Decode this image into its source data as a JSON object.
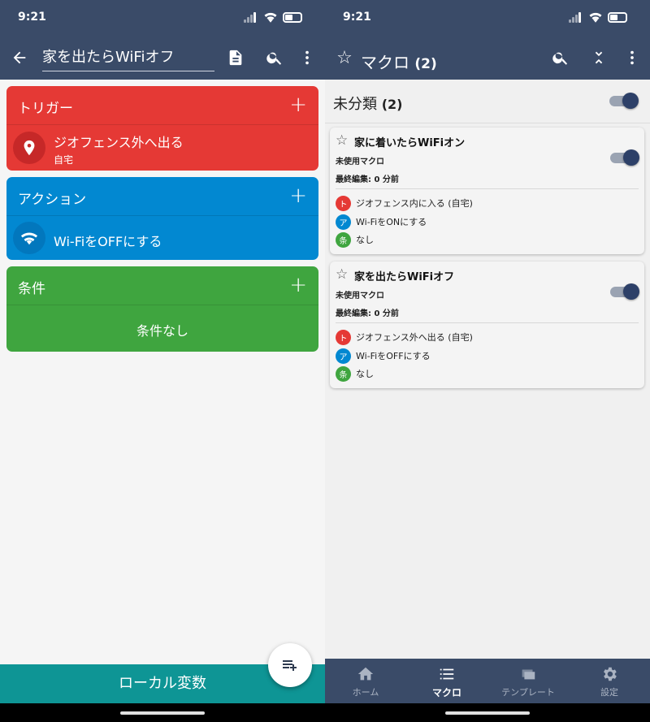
{
  "left": {
    "status_time": "9:21",
    "macro_name": "家を出たらWiFiオフ",
    "trigger": {
      "title": "トリガー",
      "item_label": "ジオフェンス外へ出る",
      "item_sub": "自宅",
      "color": "#e53935"
    },
    "action": {
      "title": "アクション",
      "item_label": "Wi-FiをOFFにする",
      "color": "#0288d1"
    },
    "constraint": {
      "title": "条件",
      "empty_label": "条件なし",
      "color": "#3fa53f"
    },
    "local_vars_label": "ローカル変数"
  },
  "right": {
    "status_time": "9:21",
    "title": "マクロ",
    "title_count": "(2)",
    "category": {
      "name": "未分類",
      "count": "(2)"
    },
    "macros": [
      {
        "name": "家に着いたらWiFiオン",
        "status": "未使用マクロ",
        "last_edit": "最終編集: 0 分前",
        "rows": [
          {
            "badge": "ト",
            "color": "#e53935",
            "text": "ジオフェンス内に入る (自宅)"
          },
          {
            "badge": "ア",
            "color": "#0288d1",
            "text": "Wi-FiをONにする"
          },
          {
            "badge": "条",
            "color": "#3fa53f",
            "text": "なし"
          }
        ]
      },
      {
        "name": "家を出たらWiFiオフ",
        "status": "未使用マクロ",
        "last_edit": "最終編集: 0 分前",
        "rows": [
          {
            "badge": "ト",
            "color": "#e53935",
            "text": "ジオフェンス外へ出る (自宅)"
          },
          {
            "badge": "ア",
            "color": "#0288d1",
            "text": "Wi-FiをOFFにする"
          },
          {
            "badge": "条",
            "color": "#3fa53f",
            "text": "なし"
          }
        ]
      }
    ],
    "fab_label": "+",
    "nav": [
      {
        "label": "ホーム",
        "icon": "home-icon"
      },
      {
        "label": "マクロ",
        "icon": "list-icon"
      },
      {
        "label": "テンプレート",
        "icon": "templates-icon"
      },
      {
        "label": "設定",
        "icon": "gear-icon"
      }
    ]
  }
}
